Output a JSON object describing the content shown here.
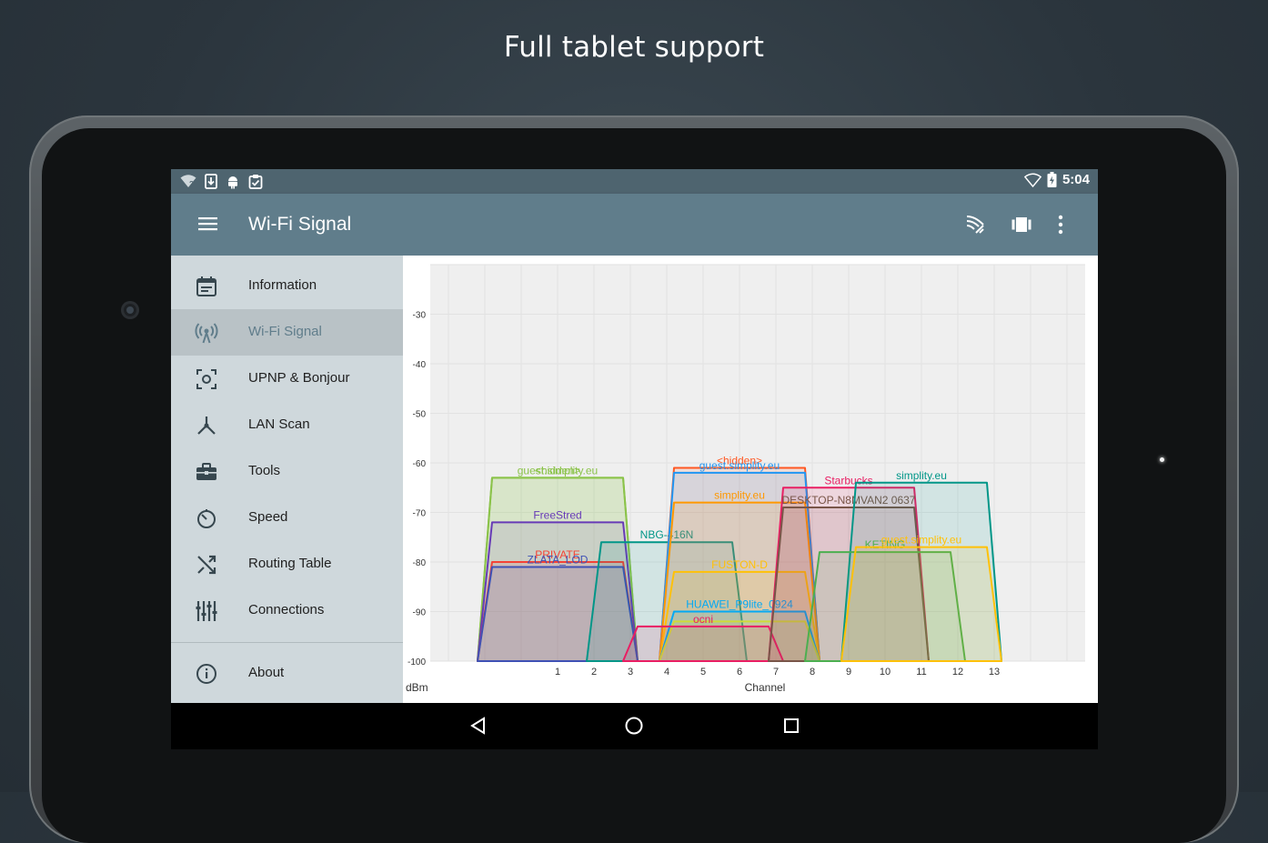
{
  "headline": "Full tablet support",
  "status_bar": {
    "left_icons": [
      "wifi-question-icon",
      "download-icon",
      "android-icon",
      "clipboard-check-icon"
    ],
    "right_icons": [
      "wifi-outline-icon",
      "battery-charging-icon"
    ],
    "time": "5:04"
  },
  "app_bar": {
    "title": "Wi-Fi Signal",
    "actions": [
      "signal-scan-icon",
      "view-carousel-icon",
      "more-vert-icon"
    ]
  },
  "drawer": {
    "items": [
      {
        "label": "Information",
        "icon": "calendar-icon",
        "active": false
      },
      {
        "label": "Wi-Fi Signal",
        "icon": "wifi-tower-icon",
        "active": true
      },
      {
        "label": "UPNP & Bonjour",
        "icon": "scan-target-icon",
        "active": false
      },
      {
        "label": "LAN Scan",
        "icon": "network-icon",
        "active": false
      },
      {
        "label": "Tools",
        "icon": "toolbox-icon",
        "active": false
      },
      {
        "label": "Speed",
        "icon": "timer-icon",
        "active": false
      },
      {
        "label": "Routing Table",
        "icon": "shuffle-icon",
        "active": false
      },
      {
        "label": "Connections",
        "icon": "equalizer-icon",
        "active": false
      },
      {
        "label": "About",
        "icon": "info-icon",
        "active": false
      }
    ]
  },
  "nav_bar": [
    "back-icon",
    "home-icon",
    "recents-icon"
  ],
  "chart_data": {
    "type": "area",
    "xlabel": "Channel",
    "ylabel": "dBm",
    "x_ticks": [
      1,
      2,
      3,
      4,
      5,
      6,
      7,
      8,
      9,
      10,
      11,
      12,
      13
    ],
    "y_ticks": [
      -30,
      -40,
      -50,
      -60,
      -70,
      -80,
      -90,
      -100
    ],
    "xlim": [
      -2.5,
      15.5
    ],
    "ylim": [
      -100,
      -20
    ],
    "grid": true,
    "series": [
      {
        "name": "guest.simplity.eu",
        "channel": 1,
        "signal": -63,
        "color": "#8bc34a"
      },
      {
        "name": "<hidden>",
        "channel": 1,
        "signal": -63,
        "color": "#8bc34a"
      },
      {
        "name": "FreeStred",
        "channel": 1,
        "signal": -72,
        "color": "#673ab7"
      },
      {
        "name": "PRIVATE",
        "channel": 1,
        "signal": -80,
        "color": "#f44336"
      },
      {
        "name": "ZLATA_LOD",
        "channel": 1,
        "signal": -81,
        "color": "#3f51b5"
      },
      {
        "name": "NBG-416N",
        "channel": 4,
        "signal": -76,
        "color": "#009688"
      },
      {
        "name": "<hidden>",
        "channel": 6,
        "signal": -61,
        "color": "#ff5722"
      },
      {
        "name": "guest.simplity.eu",
        "channel": 6,
        "signal": -62,
        "color": "#2196f3"
      },
      {
        "name": "simplity.eu",
        "channel": 6,
        "signal": -68,
        "color": "#ff9800"
      },
      {
        "name": "FUSTON-D",
        "channel": 6,
        "signal": -82,
        "color": "#ffc107"
      },
      {
        "name": "HUAWEI_P9lite_0924",
        "channel": 6,
        "signal": -90,
        "color": "#03a9f4"
      },
      {
        "name": "",
        "channel": 6,
        "signal": -92,
        "color": "#cddc39"
      },
      {
        "name": "ocni",
        "channel": 5,
        "signal": -93,
        "color": "#e91e63"
      },
      {
        "name": "Starbucks",
        "channel": 9,
        "signal": -65,
        "color": "#e91e63"
      },
      {
        "name": "DESKTOP-N8MVAN2 0637",
        "channel": 9,
        "signal": -69,
        "color": "#795548"
      },
      {
        "name": "simplity.eu",
        "channel": 11,
        "signal": -64,
        "color": "#009688"
      },
      {
        "name": "KETING",
        "channel": 10,
        "signal": -78,
        "color": "#4caf50"
      },
      {
        "name": "guest.simplity.eu",
        "channel": 11,
        "signal": -77,
        "color": "#ffc107"
      }
    ]
  }
}
